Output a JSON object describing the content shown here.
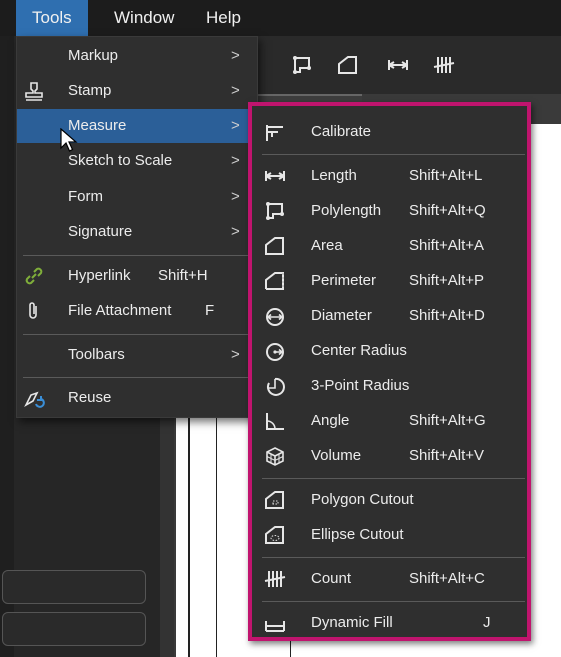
{
  "menubar": {
    "items": [
      {
        "label": "Tools",
        "active": true
      },
      {
        "label": "Window",
        "active": false
      },
      {
        "label": "Help",
        "active": false
      }
    ]
  },
  "tools_menu": {
    "items": [
      {
        "label": "Markup",
        "shortcut": "",
        "submenu": true,
        "icon": "none"
      },
      {
        "label": "Stamp",
        "shortcut": "",
        "submenu": true,
        "icon": "stamp-icon"
      },
      {
        "label": "Measure",
        "shortcut": "",
        "submenu": true,
        "icon": "none",
        "highlighted": true
      },
      {
        "label": "Sketch to Scale",
        "shortcut": "",
        "submenu": true,
        "icon": "none"
      },
      {
        "label": "Form",
        "shortcut": "",
        "submenu": true,
        "icon": "none"
      },
      {
        "label": "Signature",
        "shortcut": "",
        "submenu": true,
        "icon": "none"
      },
      {
        "label": "Hyperlink",
        "shortcut": "Shift+H",
        "submenu": false,
        "icon": "link-icon"
      },
      {
        "label": "File Attachment",
        "shortcut": "F",
        "submenu": false,
        "icon": "paperclip-icon"
      },
      {
        "label": "Toolbars",
        "shortcut": "",
        "submenu": true,
        "icon": "none"
      },
      {
        "label": "Reuse",
        "shortcut": "",
        "submenu": false,
        "icon": "reuse-icon"
      }
    ],
    "chevron": ">"
  },
  "measure_submenu": {
    "items": [
      {
        "label": "Calibrate",
        "shortcut": "",
        "icon": "calibrate-icon"
      },
      {
        "label": "Length",
        "shortcut": "Shift+Alt+L",
        "icon": "length-icon"
      },
      {
        "label": "Polylength",
        "shortcut": "Shift+Alt+Q",
        "icon": "polylength-icon"
      },
      {
        "label": "Area",
        "shortcut": "Shift+Alt+A",
        "icon": "area-icon"
      },
      {
        "label": "Perimeter",
        "shortcut": "Shift+Alt+P",
        "icon": "perimeter-icon"
      },
      {
        "label": "Diameter",
        "shortcut": "Shift+Alt+D",
        "icon": "diameter-icon"
      },
      {
        "label": "Center Radius",
        "shortcut": "",
        "icon": "center-radius-icon"
      },
      {
        "label": "3-Point Radius",
        "shortcut": "",
        "icon": "three-point-radius-icon"
      },
      {
        "label": "Angle",
        "shortcut": "Shift+Alt+G",
        "icon": "angle-icon"
      },
      {
        "label": "Volume",
        "shortcut": "Shift+Alt+V",
        "icon": "volume-icon"
      },
      {
        "label": "Polygon Cutout",
        "shortcut": "",
        "icon": "polygon-cutout-icon"
      },
      {
        "label": "Ellipse Cutout",
        "shortcut": "",
        "icon": "ellipse-cutout-icon"
      },
      {
        "label": "Count",
        "shortcut": "Shift+Alt+C",
        "icon": "count-icon"
      },
      {
        "label": "Dynamic Fill",
        "shortcut": "J",
        "icon": "dynamic-fill-icon"
      }
    ]
  },
  "colors": {
    "menubar_bg": "#1c1c1c",
    "menu_bg": "#2f2f2f",
    "highlight": "#2b5f98",
    "submenu_border": "#c0146e",
    "link_icon": "#7fae3a",
    "reuse_icon_accent": "#3a8fd8"
  }
}
